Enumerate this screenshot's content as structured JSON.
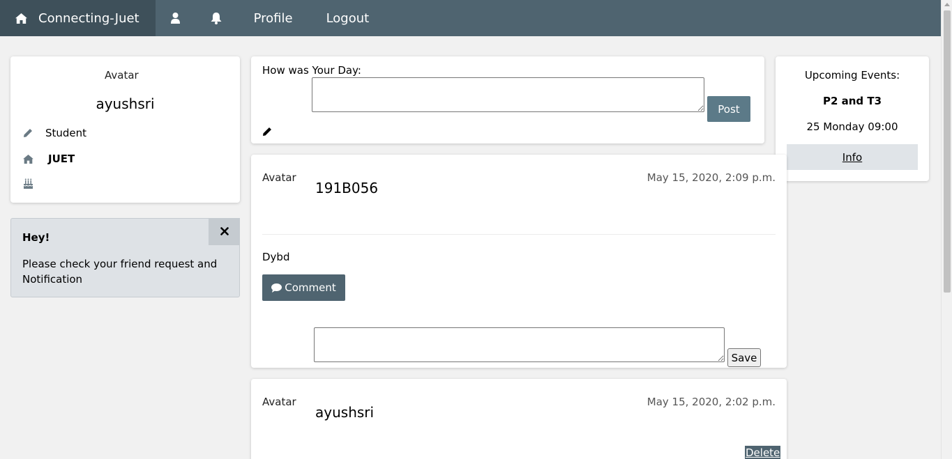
{
  "nav": {
    "brand": "Connecting-Juet",
    "brand_icon": "home-icon",
    "friends_icon": "user-icon",
    "notifications_icon": "bell-icon",
    "profile": "Profile",
    "logout": "Logout"
  },
  "profile_card": {
    "avatar_alt": "Avatar",
    "username": "ayushsri",
    "role": "Student",
    "role_icon": "pencil-icon",
    "college": "JUET",
    "college_icon": "home-icon",
    "birthday_icon": "birthday-cake-icon",
    "birthday": ""
  },
  "alert": {
    "title": "Hey!",
    "message": "Please check your friend request and Notification",
    "close_icon": "close-icon"
  },
  "composer": {
    "label": "How was Your Day:",
    "text": "",
    "post_button": "Post",
    "edit_icon": "pencil-icon"
  },
  "events": {
    "heading": "Upcoming Events:",
    "event_name": "P2 and T3",
    "event_time": "25 Monday 09:00",
    "info_link": "Info"
  },
  "posts": [
    {
      "avatar_alt": "Avatar",
      "author": "191B056",
      "date": "May 15, 2020, 2:09 p.m.",
      "body": "Dybd",
      "comment_button": "Comment",
      "comment_text": "",
      "save_button": "Save"
    },
    {
      "avatar_alt": "Avatar",
      "author": "ayushsri",
      "date": "May 15, 2020, 2:02 p.m.",
      "delete_button": "Delete"
    }
  ],
  "colors": {
    "navbar": "#4f6470",
    "navbar_brand": "#3e505a",
    "button_dark": "#5c7a88",
    "alert_bg": "#dee2e6"
  }
}
